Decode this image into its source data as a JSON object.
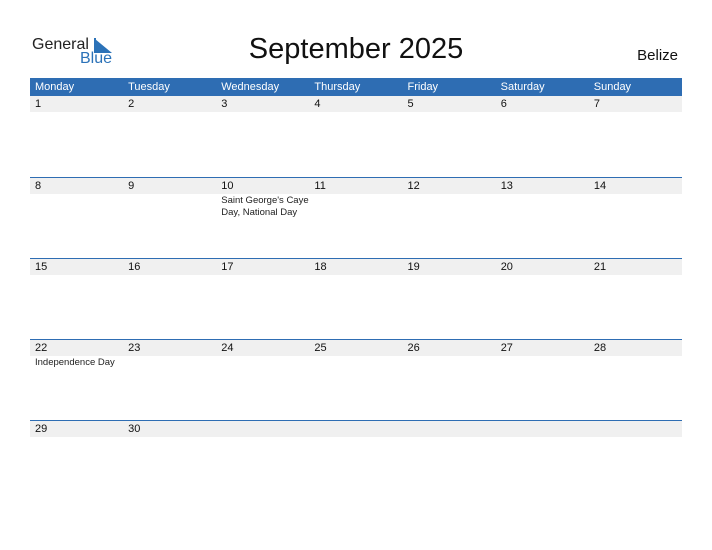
{
  "logo": {
    "word1": "General",
    "word2": "Blue"
  },
  "title": "September 2025",
  "country": "Belize",
  "weekdays": [
    "Monday",
    "Tuesday",
    "Wednesday",
    "Thursday",
    "Friday",
    "Saturday",
    "Sunday"
  ],
  "weeks": [
    [
      {
        "d": "1"
      },
      {
        "d": "2"
      },
      {
        "d": "3"
      },
      {
        "d": "4"
      },
      {
        "d": "5"
      },
      {
        "d": "6"
      },
      {
        "d": "7"
      }
    ],
    [
      {
        "d": "8"
      },
      {
        "d": "9"
      },
      {
        "d": "10",
        "e": "Saint George's Caye Day, National Day"
      },
      {
        "d": "11"
      },
      {
        "d": "12"
      },
      {
        "d": "13"
      },
      {
        "d": "14"
      }
    ],
    [
      {
        "d": "15"
      },
      {
        "d": "16"
      },
      {
        "d": "17"
      },
      {
        "d": "18"
      },
      {
        "d": "19"
      },
      {
        "d": "20"
      },
      {
        "d": "21"
      }
    ],
    [
      {
        "d": "22",
        "e": "Independence Day"
      },
      {
        "d": "23"
      },
      {
        "d": "24"
      },
      {
        "d": "25"
      },
      {
        "d": "26"
      },
      {
        "d": "27"
      },
      {
        "d": "28"
      }
    ],
    [
      {
        "d": "29"
      },
      {
        "d": "30"
      },
      {
        "d": ""
      },
      {
        "d": ""
      },
      {
        "d": ""
      },
      {
        "d": ""
      },
      {
        "d": ""
      }
    ]
  ]
}
